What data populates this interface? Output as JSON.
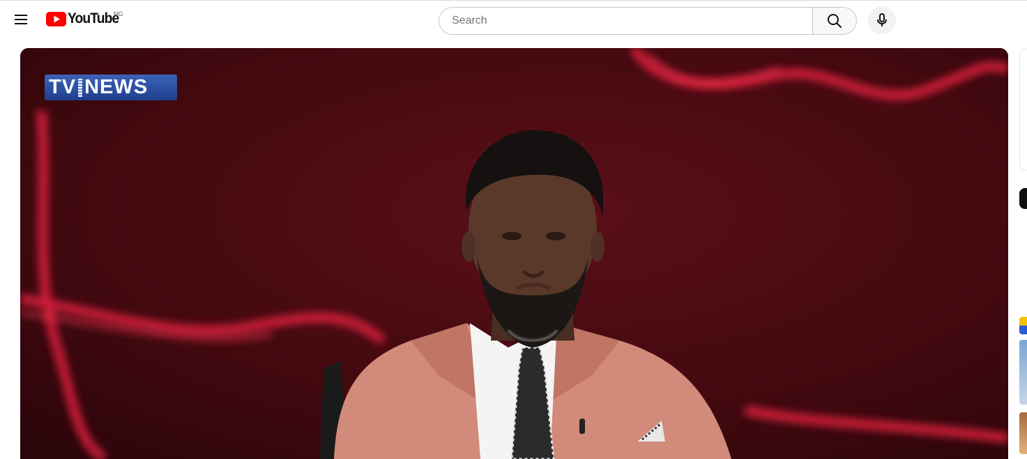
{
  "header": {
    "menu_icon": "hamburger-menu-icon",
    "logo_text": "YouTube",
    "country_code": "NG",
    "search": {
      "placeholder": "Search",
      "value": ""
    },
    "search_icon": "search-icon",
    "mic_icon": "microphone-icon"
  },
  "player": {
    "channel_bug_left": "TV",
    "channel_bug_right": "NEWS"
  },
  "colors": {
    "brand_red": "#ff0000",
    "background": "#ffffff",
    "text": "#0f0f0f",
    "border": "#c6c6c6",
    "channel_bug_blue": "#2a4fa6"
  }
}
